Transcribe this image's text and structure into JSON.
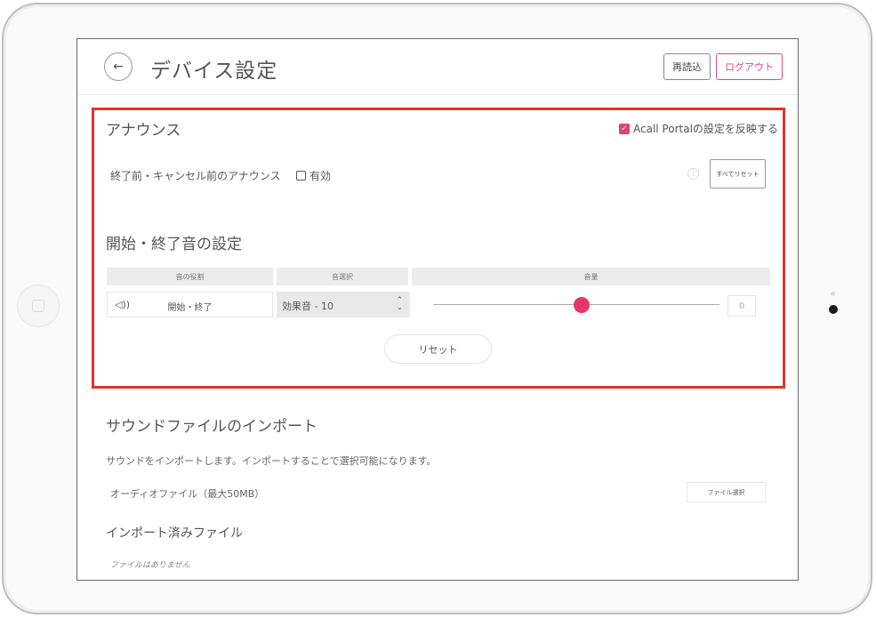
{
  "header": {
    "back_icon": "←",
    "title": "デバイス設定",
    "reload_label": "再読込",
    "logout_label": "ログアウト"
  },
  "announce": {
    "title": "アナウンス",
    "reflect_label": "Acall Portalの設定を反映する",
    "reflect_checked": true,
    "pre_end_label": "終了前・キャンセル前のアナウンス",
    "enable_label": "有効",
    "enable_checked": false,
    "reset_all_label": "すべてリセット"
  },
  "sound": {
    "title": "開始・終了音の設定",
    "columns": [
      "音の役割",
      "音選択",
      "音量"
    ],
    "row": {
      "role": "開始・終了",
      "selection": "効果音 - 10",
      "volume_fraction": 0.52,
      "volume_value": "0"
    },
    "reset_label": "リセット"
  },
  "import": {
    "title": "サウンドファイルのインポート",
    "description": "サウンドをインポートします。インポートすることで選択可能になります。",
    "audio_label": "オーディオファイル（最大50MB）",
    "file_select_label": "ファイル選択",
    "imported_title": "インポート済みファイル",
    "no_files": "ファイルはありません"
  },
  "colors": {
    "accent": "#e8366a",
    "highlight_border": "#e0342c"
  }
}
